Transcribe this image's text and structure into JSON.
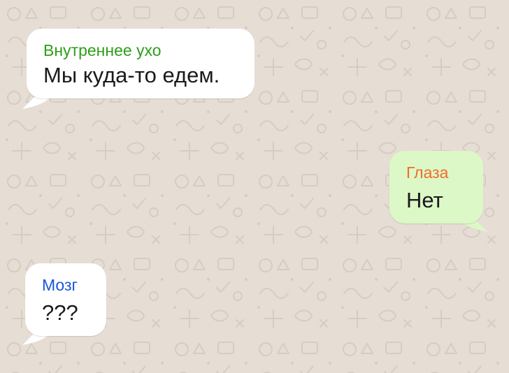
{
  "chat": {
    "messages": [
      {
        "sender": "Внутреннее ухо",
        "text": "Мы куда-то едем.",
        "direction": "incoming",
        "sender_color": "#2e9e1a"
      },
      {
        "sender": "Глаза",
        "text": "Нет",
        "direction": "outgoing",
        "sender_color": "#f26a2b"
      },
      {
        "sender": "Мозг",
        "text": "???",
        "direction": "incoming",
        "sender_color": "#1a56db"
      }
    ]
  },
  "colors": {
    "background": "#e6ddd4",
    "incoming_bubble": "#ffffff",
    "outgoing_bubble": "#dcf8c6"
  }
}
